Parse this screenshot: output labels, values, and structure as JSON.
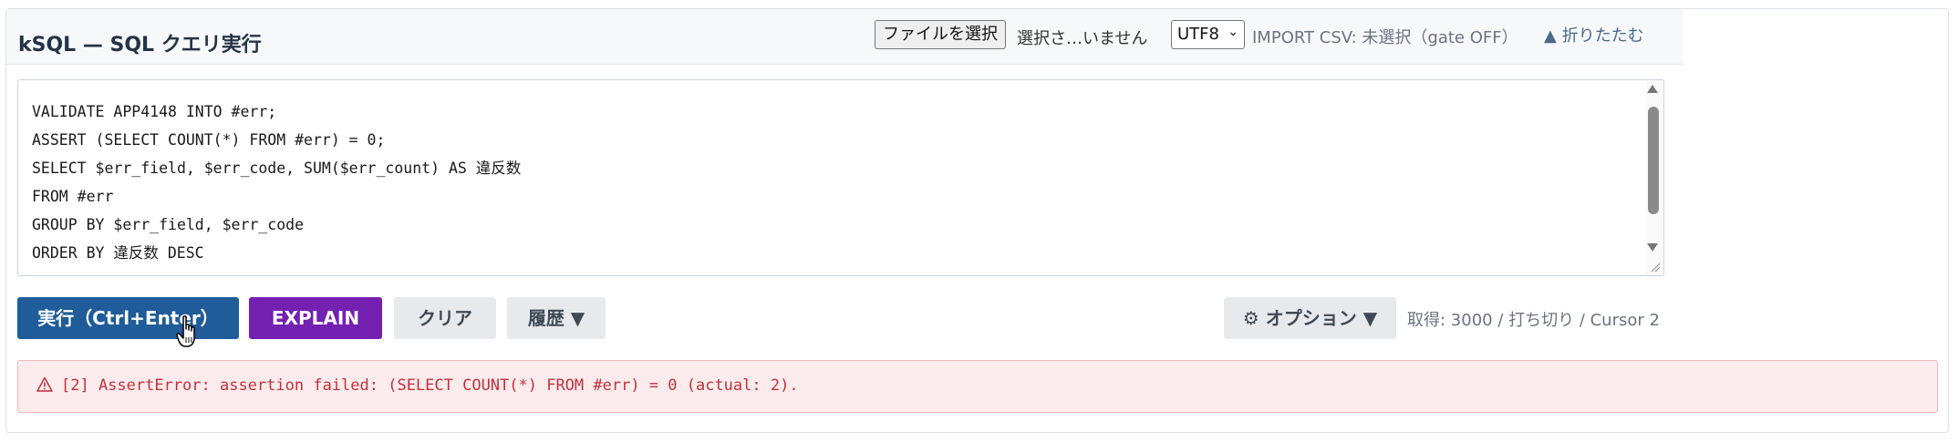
{
  "header": {
    "title": "kSQL — SQL クエリ実行",
    "file_button_label": "ファイルを選択",
    "file_status": "選択さ…いません",
    "encoding": "UTF8",
    "import_status": "IMPORT CSV: 未選択（gate OFF）",
    "collapse_label": "▲ 折りたたむ"
  },
  "editor": {
    "code": "VALIDATE APP4148 INTO #err;\nASSERT (SELECT COUNT(*) FROM #err) = 0;\nSELECT $err_field, $err_code, SUM($err_count) AS 違反数\nFROM #err\nGROUP BY $err_field, $err_code\nORDER BY 違反数 DESC"
  },
  "toolbar": {
    "run_label": "実行（Ctrl+Enter）",
    "explain_label": "EXPLAIN",
    "clear_label": "クリア",
    "history_label": "履歴 ▼",
    "options_label": "⚙ オプション ▼",
    "fetch_status": "取得: 3000 / 打ち切り / Cursor 2"
  },
  "error": {
    "message": "[2] AssertError: assertion failed: (SELECT COUNT(*) FROM #err) = 0 (actual: 2)."
  },
  "colors": {
    "run_button": "#1f5c99",
    "explain_button": "#7421b2",
    "error_text": "#c0313d",
    "error_bg": "#fcebec"
  },
  "icons": {
    "alert": "warning-triangle-icon",
    "cursor": "hand-pointer-icon"
  }
}
